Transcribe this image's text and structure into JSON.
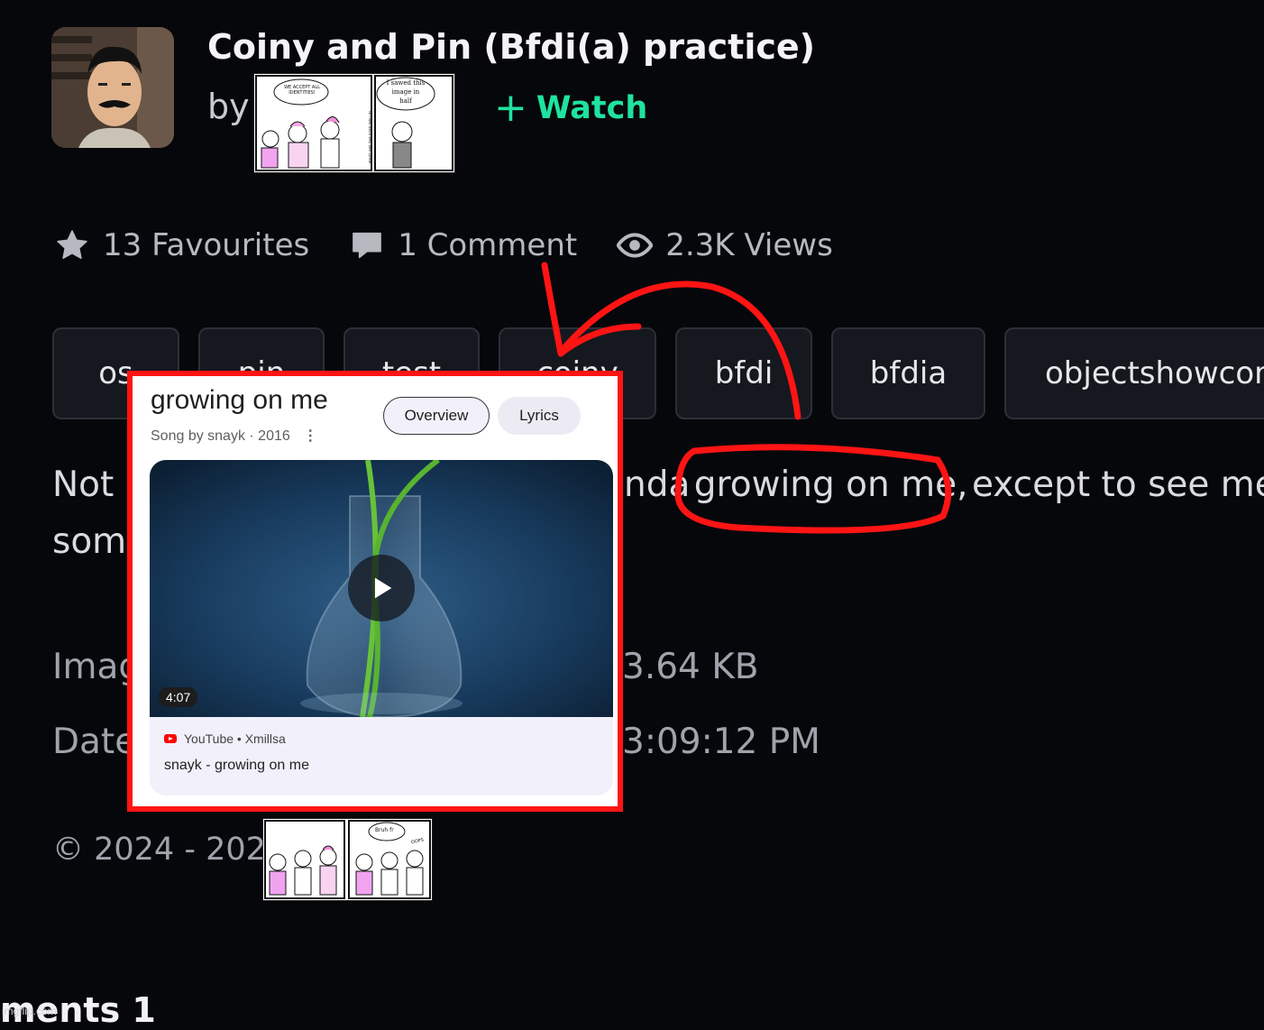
{
  "header": {
    "title": "Coiny and Pin (Bfdi(a) practice)",
    "by_label": "by",
    "watch_label": "Watch"
  },
  "stats": {
    "favourites": "13 Favourites",
    "comments": "1 Comment",
    "views": "2.3K Views"
  },
  "tags": [
    "os",
    "pin",
    "test",
    "coiny",
    "bfdi",
    "bfdia",
    "objectshowcom"
  ],
  "description": {
    "line1_left": "Not",
    "line1_mid": "nda",
    "line1_highlight": "growing on me,",
    "line1_right": "except to see me fo",
    "line2_left": "som"
  },
  "meta": {
    "image_left": "Imag",
    "image_right": "3.64 KB",
    "date_left": "Date",
    "date_right": "3:09:12 PM"
  },
  "footer": {
    "copyright": "© 2024 - 2025",
    "comments_heading": "ments 1",
    "watermark": "imgflip.com"
  },
  "comic_top": {
    "speech_left": "WE ACCEPT ALL IDENTITIES!",
    "speech_right": "I sawed this image in half",
    "side_text": "WHAT ARE THE FUSS WALLIN"
  },
  "comic_bottom": {
    "speech": "Bruh fr",
    "exclaim": "OOPS"
  },
  "popup": {
    "song_title": "growing on me",
    "subtitle": "Song by snayk · 2016",
    "tabs": [
      "Overview",
      "Lyrics"
    ],
    "duration": "4:07",
    "source": "YouTube • Xmillsa",
    "video_title": "snayk - growing on me"
  },
  "colors": {
    "background": "#06070b",
    "accent_watch": "#1fe39f",
    "annotation_red": "#ff1414",
    "youtube_red": "#ff0000"
  }
}
